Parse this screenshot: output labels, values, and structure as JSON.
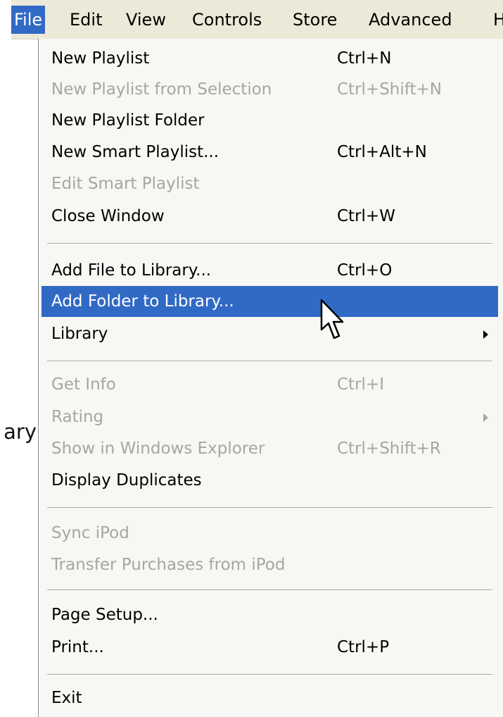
{
  "background_text": "ary",
  "menubar": {
    "items": [
      {
        "label": "File",
        "active": true
      },
      {
        "label": "Edit"
      },
      {
        "label": "View"
      },
      {
        "label": "Controls"
      },
      {
        "label": "Store"
      },
      {
        "label": "Advanced"
      },
      {
        "label": "H"
      }
    ]
  },
  "menu": {
    "items": [
      {
        "label": "New Playlist",
        "shortcut": "Ctrl+N"
      },
      {
        "label": "New Playlist from Selection",
        "shortcut": "Ctrl+Shift+N",
        "disabled": true
      },
      {
        "label": "New Playlist Folder",
        "shortcut": ""
      },
      {
        "label": "New Smart Playlist...",
        "shortcut": "Ctrl+Alt+N"
      },
      {
        "label": "Edit Smart Playlist",
        "shortcut": "",
        "disabled": true
      },
      {
        "label": "Close Window",
        "shortcut": "Ctrl+W"
      },
      {
        "label": "Add File to Library...",
        "shortcut": "Ctrl+O"
      },
      {
        "label": "Add Folder to Library...",
        "shortcut": "",
        "highlighted": true
      },
      {
        "label": "Library",
        "shortcut": "",
        "submenu": true
      },
      {
        "label": "Get Info",
        "shortcut": "Ctrl+I",
        "disabled": true
      },
      {
        "label": "Rating",
        "shortcut": "",
        "disabled": true,
        "submenu": true
      },
      {
        "label": "Show in Windows Explorer",
        "shortcut": "Ctrl+Shift+R",
        "disabled": true
      },
      {
        "label": "Display Duplicates",
        "shortcut": ""
      },
      {
        "label": "Sync iPod",
        "shortcut": "",
        "disabled": true
      },
      {
        "label": "Transfer Purchases from iPod",
        "shortcut": "",
        "disabled": true
      },
      {
        "label": "Page Setup...",
        "shortcut": ""
      },
      {
        "label": "Print...",
        "shortcut": "Ctrl+P"
      },
      {
        "label": "Exit",
        "shortcut": ""
      }
    ]
  },
  "colors": {
    "highlight": "#316ac5",
    "menubar_bg": "#ece9d8",
    "menu_bg": "#f7f7f4",
    "disabled_text": "#a7a6a0"
  },
  "cursor_icon": "arrow-cursor-icon"
}
